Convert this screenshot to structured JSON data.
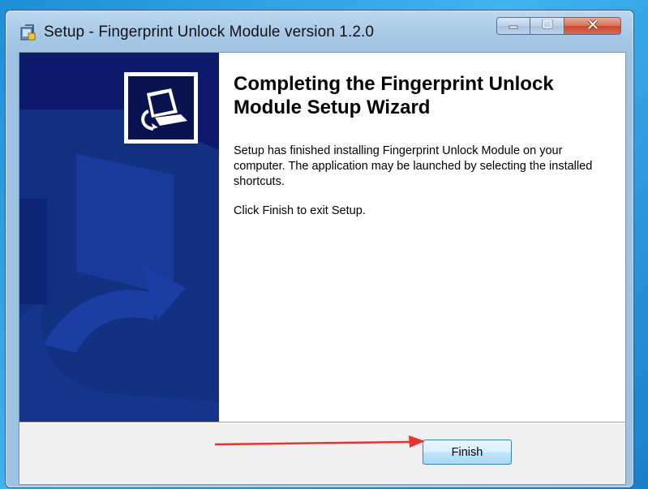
{
  "window": {
    "title": "Setup - Fingerprint Unlock Module version 1.2.0",
    "controls": [
      "minimize-icon",
      "maximize-icon",
      "close-icon"
    ]
  },
  "banner": {
    "colors": {
      "background": "#0b1a6b",
      "shape": "#16389a",
      "logo_frame": "#ffffff"
    },
    "logo_icon": "installer-logo-icon"
  },
  "wizard": {
    "heading": "Completing the Fingerprint Unlock Module Setup Wizard",
    "paragraphs": [
      "Setup has finished installing Fingerprint Unlock Module on your computer. The application may be launched by selecting the installed shortcuts.",
      "Click Finish to exit Setup."
    ]
  },
  "buttons": {
    "finish_label": "Finish"
  },
  "annotation": {
    "type": "arrow",
    "color": "#e8322b",
    "points_to": "finish-button"
  }
}
